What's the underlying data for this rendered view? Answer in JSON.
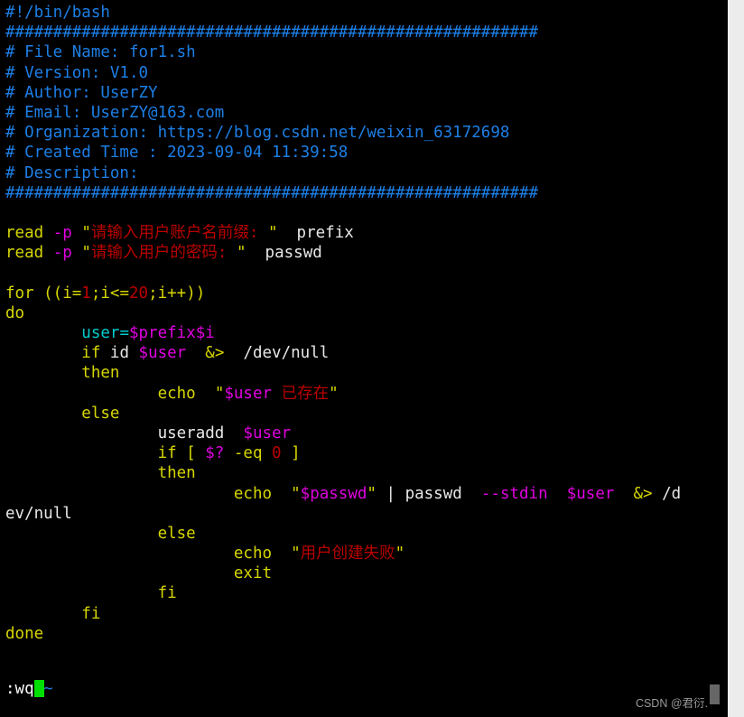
{
  "window": {
    "app": "vim",
    "background_color": "#000000",
    "right_strip_color": "#ececec"
  },
  "colors": {
    "comment_blue": "#1d7fe6",
    "keyword_yellow": "#d6d600",
    "variable_magenta": "#e000e0",
    "string_red": "#bb0000",
    "number_red": "#bb0000",
    "assignment_cyan": "#00cdcd",
    "plain_white": "#e8e8e8",
    "cursor_green": "#00e000",
    "watermark_gray": "#9a9a9a"
  },
  "editor": {
    "lines": [
      {
        "n": 1,
        "segments": [
          {
            "t": "#!/bin/bash",
            "c": "cmt"
          }
        ]
      },
      {
        "n": 2,
        "segments": [
          {
            "t": "########################################################",
            "c": "cmt"
          }
        ]
      },
      {
        "n": 3,
        "segments": [
          {
            "t": "# File Name: for1.sh",
            "c": "cmt"
          }
        ]
      },
      {
        "n": 4,
        "segments": [
          {
            "t": "# Version: V1.0",
            "c": "cmt"
          }
        ]
      },
      {
        "n": 5,
        "segments": [
          {
            "t": "# Author: UserZY",
            "c": "cmt"
          }
        ]
      },
      {
        "n": 6,
        "segments": [
          {
            "t": "# Email: UserZY@163.com",
            "c": "cmt"
          }
        ]
      },
      {
        "n": 7,
        "segments": [
          {
            "t": "# Organization: https://blog.csdn.net/weixin_63172698",
            "c": "cmt"
          }
        ]
      },
      {
        "n": 8,
        "segments": [
          {
            "t": "# Created Time : 2023-09-04 11:39:58",
            "c": "cmt"
          }
        ]
      },
      {
        "n": 9,
        "segments": [
          {
            "t": "# Description:",
            "c": "cmt"
          }
        ]
      },
      {
        "n": 10,
        "segments": [
          {
            "t": "########################################################",
            "c": "cmt"
          }
        ]
      },
      {
        "n": 11,
        "segments": []
      },
      {
        "n": 12,
        "segments": [
          {
            "t": "read ",
            "c": "kw"
          },
          {
            "t": "-p",
            "c": "opt"
          },
          {
            "t": " ",
            "c": "plain"
          },
          {
            "t": "\"",
            "c": "quote"
          },
          {
            "t": "请输入用户账户名前缀: ",
            "c": "str"
          },
          {
            "t": "\"",
            "c": "quote"
          },
          {
            "t": "  prefix",
            "c": "plain"
          }
        ]
      },
      {
        "n": 13,
        "segments": [
          {
            "t": "read ",
            "c": "kw"
          },
          {
            "t": "-p",
            "c": "opt"
          },
          {
            "t": " ",
            "c": "plain"
          },
          {
            "t": "\"",
            "c": "quote"
          },
          {
            "t": "请输入用户的密码: ",
            "c": "str"
          },
          {
            "t": "\"",
            "c": "quote"
          },
          {
            "t": "  passwd",
            "c": "plain"
          }
        ]
      },
      {
        "n": 14,
        "segments": []
      },
      {
        "n": 15,
        "segments": [
          {
            "t": "for ((i=",
            "c": "kw"
          },
          {
            "t": "1",
            "c": "num"
          },
          {
            "t": ";i<=",
            "c": "kw"
          },
          {
            "t": "20",
            "c": "num"
          },
          {
            "t": ";i++))",
            "c": "kw"
          }
        ]
      },
      {
        "n": 16,
        "segments": [
          {
            "t": "do",
            "c": "kw"
          }
        ]
      },
      {
        "n": 17,
        "segments": [
          {
            "t": "        ",
            "c": "plain"
          },
          {
            "t": "user=",
            "c": "assign"
          },
          {
            "t": "$prefix$i",
            "c": "var"
          }
        ]
      },
      {
        "n": 18,
        "segments": [
          {
            "t": "        ",
            "c": "plain"
          },
          {
            "t": "if",
            "c": "kw"
          },
          {
            "t": " id ",
            "c": "plain"
          },
          {
            "t": "$user",
            "c": "var"
          },
          {
            "t": "  ",
            "c": "plain"
          },
          {
            "t": "&>",
            "c": "redir"
          },
          {
            "t": "  /dev/null",
            "c": "plain"
          }
        ]
      },
      {
        "n": 19,
        "segments": [
          {
            "t": "        ",
            "c": "plain"
          },
          {
            "t": "then",
            "c": "kw"
          }
        ]
      },
      {
        "n": 20,
        "segments": [
          {
            "t": "                ",
            "c": "plain"
          },
          {
            "t": "echo",
            "c": "kw"
          },
          {
            "t": "  ",
            "c": "plain"
          },
          {
            "t": "\"",
            "c": "quote"
          },
          {
            "t": "$user",
            "c": "var"
          },
          {
            "t": " 已存在",
            "c": "str"
          },
          {
            "t": "\"",
            "c": "quote"
          }
        ]
      },
      {
        "n": 21,
        "segments": [
          {
            "t": "        ",
            "c": "plain"
          },
          {
            "t": "else",
            "c": "kw"
          }
        ]
      },
      {
        "n": 22,
        "segments": [
          {
            "t": "                ",
            "c": "plain"
          },
          {
            "t": "useradd",
            "c": "plain"
          },
          {
            "t": "  ",
            "c": "plain"
          },
          {
            "t": "$user",
            "c": "var"
          }
        ]
      },
      {
        "n": 23,
        "segments": [
          {
            "t": "                ",
            "c": "plain"
          },
          {
            "t": "if [ ",
            "c": "kw"
          },
          {
            "t": "$?",
            "c": "var"
          },
          {
            "t": " -eq ",
            "c": "kw"
          },
          {
            "t": "0",
            "c": "num"
          },
          {
            "t": " ]",
            "c": "kw"
          }
        ]
      },
      {
        "n": 24,
        "segments": [
          {
            "t": "                ",
            "c": "plain"
          },
          {
            "t": "then",
            "c": "kw"
          }
        ]
      },
      {
        "n": 25,
        "segments": [
          {
            "t": "                        ",
            "c": "plain"
          },
          {
            "t": "echo",
            "c": "kw"
          },
          {
            "t": "  ",
            "c": "plain"
          },
          {
            "t": "\"",
            "c": "quote"
          },
          {
            "t": "$passwd",
            "c": "var"
          },
          {
            "t": "\"",
            "c": "quote"
          },
          {
            "t": " | ",
            "c": "pipe"
          },
          {
            "t": "passwd",
            "c": "plain"
          },
          {
            "t": "  ",
            "c": "plain"
          },
          {
            "t": "--stdin",
            "c": "opt"
          },
          {
            "t": "  ",
            "c": "plain"
          },
          {
            "t": "$user",
            "c": "var"
          },
          {
            "t": "  ",
            "c": "plain"
          },
          {
            "t": "&>",
            "c": "redir"
          },
          {
            "t": " /d",
            "c": "plain"
          }
        ]
      },
      {
        "n": 26,
        "segments": [
          {
            "t": "ev/null",
            "c": "plain"
          }
        ]
      },
      {
        "n": 27,
        "segments": [
          {
            "t": "                ",
            "c": "plain"
          },
          {
            "t": "else",
            "c": "kw"
          }
        ]
      },
      {
        "n": 28,
        "segments": [
          {
            "t": "                        ",
            "c": "plain"
          },
          {
            "t": "echo",
            "c": "kw"
          },
          {
            "t": "  ",
            "c": "plain"
          },
          {
            "t": "\"",
            "c": "quote"
          },
          {
            "t": "用户创建失败",
            "c": "str"
          },
          {
            "t": "\"",
            "c": "quote"
          }
        ]
      },
      {
        "n": 29,
        "segments": [
          {
            "t": "                        ",
            "c": "plain"
          },
          {
            "t": "exit",
            "c": "kw"
          }
        ]
      },
      {
        "n": 30,
        "segments": [
          {
            "t": "                ",
            "c": "plain"
          },
          {
            "t": "fi",
            "c": "kw"
          }
        ]
      },
      {
        "n": 31,
        "segments": [
          {
            "t": "        ",
            "c": "plain"
          },
          {
            "t": "fi",
            "c": "kw"
          }
        ]
      },
      {
        "n": 32,
        "segments": [
          {
            "t": "done",
            "c": "kw"
          }
        ]
      },
      {
        "n": 33,
        "segments": []
      },
      {
        "n": 34,
        "segments": []
      }
    ]
  },
  "empty_marker": "~",
  "status": {
    "command": ":wq"
  },
  "watermark": {
    "text": "CSDN @君衍."
  }
}
